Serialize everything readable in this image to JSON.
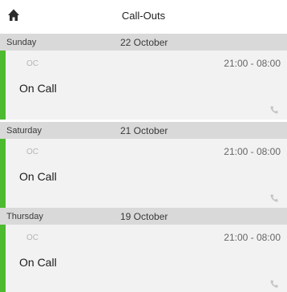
{
  "header": {
    "title": "Call-Outs",
    "home_icon": "home-icon"
  },
  "days": [
    {
      "weekday": "Sunday",
      "date": "22 October",
      "shift": {
        "code": "OC",
        "time": "21:00 - 08:00",
        "label": "On Call",
        "icon": "phone-icon"
      }
    },
    {
      "weekday": "Saturday",
      "date": "21 October",
      "shift": {
        "code": "OC",
        "time": "21:00 - 08:00",
        "label": "On Call",
        "icon": "phone-icon"
      }
    },
    {
      "weekday": "Thursday",
      "date": "19 October",
      "shift": {
        "code": "OC",
        "time": "21:00 - 08:00",
        "label": "On Call",
        "icon": "phone-icon"
      }
    }
  ],
  "colors": {
    "accent": "#4dbb2f",
    "header_bg": "#d9d9d9",
    "card_bg": "#f2f2f2"
  }
}
